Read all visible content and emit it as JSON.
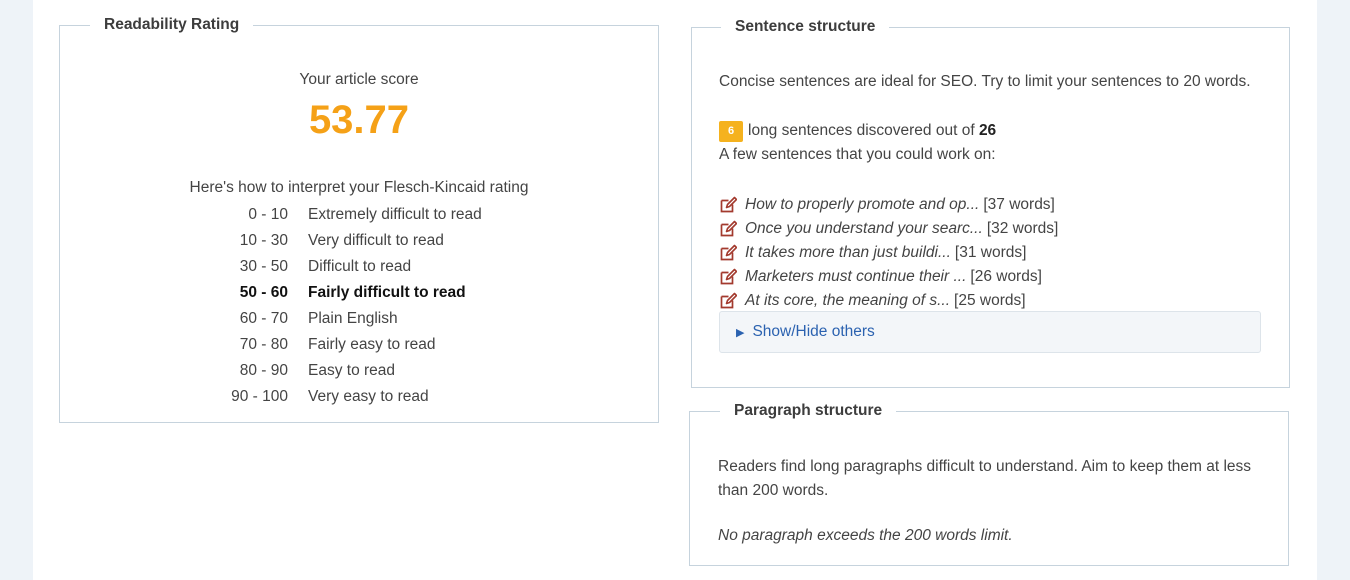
{
  "readability": {
    "title": "Readability Rating",
    "score_label": "Your article score",
    "score": "53.77",
    "interpret_title": "Here's how to interpret your Flesch-Kincaid rating",
    "ratings": [
      {
        "range": "0 - 10",
        "label": "Extremely difficult to read"
      },
      {
        "range": "10 - 30",
        "label": "Very difficult to read"
      },
      {
        "range": "30 - 50",
        "label": "Difficult to read"
      },
      {
        "range": "50 - 60",
        "label": "Fairly difficult to read"
      },
      {
        "range": "60 - 70",
        "label": "Plain English"
      },
      {
        "range": "70 - 80",
        "label": "Fairly easy to read"
      },
      {
        "range": "80 - 90",
        "label": "Easy to read"
      },
      {
        "range": "90 - 100",
        "label": "Very easy to read"
      }
    ],
    "active_index": 3,
    "score_color": "#f5a117"
  },
  "sentence": {
    "title": "Sentence structure",
    "intro": "Concise sentences are ideal for SEO. Try to limit your sentences to 20 words.",
    "long_count": "6",
    "count_text": "long sentences discovered out of",
    "total": "26",
    "work_on": "A few sentences that you could work on:",
    "items": [
      {
        "snippet": "How to properly promote and op...",
        "words": "[37 words]"
      },
      {
        "snippet": "Once you understand your searc...",
        "words": "[32 words]"
      },
      {
        "snippet": "It takes more than just buildi...",
        "words": "[31 words]"
      },
      {
        "snippet": "Marketers must continue their ...",
        "words": "[26 words]"
      },
      {
        "snippet": "At its core, the meaning of s...",
        "words": "[25 words]"
      }
    ],
    "toggle_label": "Show/Hide others",
    "toggle_icon": "triangle-right-icon",
    "item_icon": "edit-icon",
    "badge_color": "#f5b21e",
    "link_color": "#2b62b0"
  },
  "paragraph": {
    "title": "Paragraph structure",
    "intro": "Readers find long paragraphs difficult to understand. Aim to keep them at less than 200 words.",
    "status": "No paragraph exceeds the 200 words limit."
  }
}
